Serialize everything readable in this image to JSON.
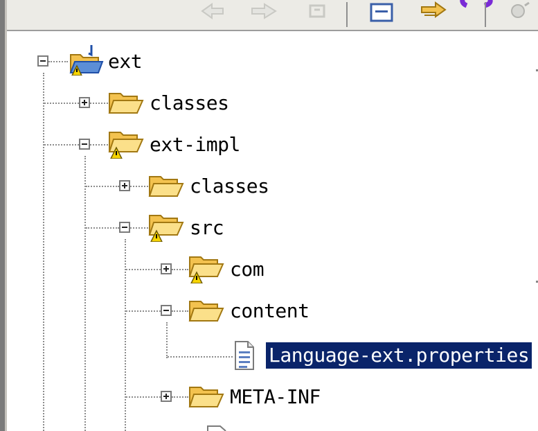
{
  "tree": {
    "nodes": [
      {
        "label": "ext",
        "expanded": true,
        "icon": "project-folder-warning-icon"
      },
      {
        "label": "classes",
        "expanded": false,
        "icon": "folder-icon"
      },
      {
        "label": "ext-impl",
        "expanded": true,
        "icon": "folder-warning-icon"
      },
      {
        "label": "classes",
        "expanded": false,
        "icon": "folder-icon"
      },
      {
        "label": "src",
        "expanded": true,
        "icon": "folder-warning-icon"
      },
      {
        "label": "com",
        "expanded": false,
        "icon": "folder-warning-icon"
      },
      {
        "label": "content",
        "expanded": true,
        "icon": "folder-icon"
      },
      {
        "label": "Language-ext.properties",
        "selected": true,
        "icon": "properties-file-icon"
      },
      {
        "label": "META-INF",
        "expanded": false,
        "icon": "folder-icon"
      }
    ]
  },
  "colors": {
    "selection": "#0a246a",
    "toolbar": "#ecebe6",
    "folder": "#f3c24f"
  }
}
